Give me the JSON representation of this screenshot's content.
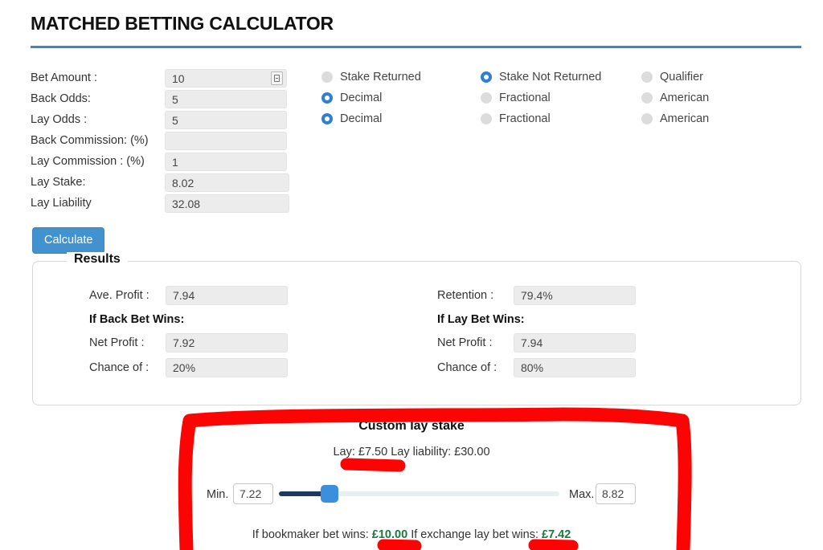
{
  "header": {
    "title": "MATCHED BETTING CALCULATOR"
  },
  "form": {
    "fields": [
      {
        "label": "Bet Amount :",
        "value": "10",
        "has_spinner": true
      },
      {
        "label": "Back Odds:",
        "value": "5",
        "has_spinner": false
      },
      {
        "label": "Lay Odds :",
        "value": "5",
        "has_spinner": false
      },
      {
        "label": "Back Commission: (%)",
        "value": "",
        "has_spinner": false
      },
      {
        "label": "Lay Commission : (%)",
        "value": "1",
        "has_spinner": false
      },
      {
        "label": "Lay Stake:",
        "value": "8.02",
        "has_spinner": false
      },
      {
        "label": "Lay Liability",
        "value": "32.08",
        "has_spinner": false
      }
    ]
  },
  "radios": {
    "rows": [
      {
        "name": "bet-type",
        "options": [
          {
            "label": "Stake Returned",
            "selected": false
          },
          {
            "label": "Stake Not Returned",
            "selected": true
          },
          {
            "label": "Qualifier",
            "selected": false
          }
        ]
      },
      {
        "name": "back-odds-format",
        "options": [
          {
            "label": "Decimal",
            "selected": true
          },
          {
            "label": "Fractional",
            "selected": false
          },
          {
            "label": "American",
            "selected": false
          }
        ]
      },
      {
        "name": "lay-odds-format",
        "options": [
          {
            "label": "Decimal",
            "selected": true
          },
          {
            "label": "Fractional",
            "selected": false
          },
          {
            "label": "American",
            "selected": false
          }
        ]
      }
    ]
  },
  "actions": {
    "calculate_label": "Calculate"
  },
  "results": {
    "legend": "Results",
    "left": {
      "summary": {
        "label": "Ave. Profit :",
        "value": "7.94"
      },
      "subheading": "If Back Bet Wins:",
      "rows": [
        {
          "label": "Net Profit :",
          "value": "7.92"
        },
        {
          "label": "Chance of :",
          "value": "20%"
        }
      ]
    },
    "right": {
      "summary": {
        "label": "Retention :",
        "value": "79.4%"
      },
      "subheading": "If Lay Bet Wins:",
      "rows": [
        {
          "label": "Net Profit :",
          "value": "7.94"
        },
        {
          "label": "Chance of :",
          "value": "80%"
        }
      ]
    }
  },
  "custom_lay_stake": {
    "title": "Custom lay stake",
    "summary": "Lay: £7.50 Lay liability: £30.00",
    "min_label": "Min.",
    "min_value": "7.22",
    "max_label": "Max.",
    "max_value": "8.82",
    "slider_percent": 18,
    "outcome": {
      "bookmaker_prefix": "If bookmaker bet wins:",
      "bookmaker_value": "£10.00",
      "exchange_prefix": "If exchange lay bet wins:",
      "exchange_value": "£7.42"
    }
  },
  "colors": {
    "accent_blue": "#3f86c8",
    "button_blue": "#4292d0",
    "radio_on": "#2f80d4",
    "money_green": "#1a7a3c",
    "annotation_red": "#fb0404",
    "slider_fill": "#1e3a5f",
    "slider_thumb": "#3b8fdd"
  }
}
